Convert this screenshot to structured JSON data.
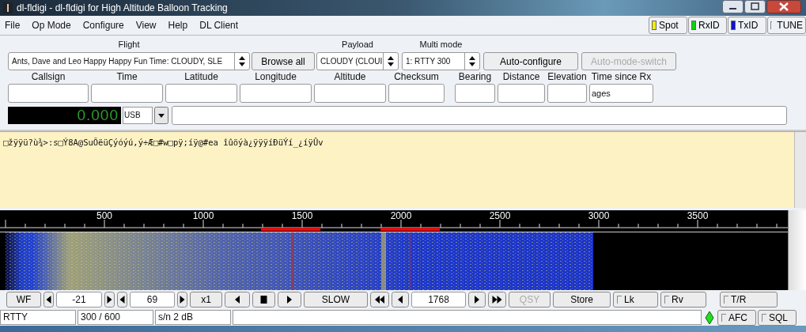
{
  "window": {
    "title": "dl-fldigi - dl-fldigi for High Altitude Balloon Tracking"
  },
  "menu": [
    "File",
    "Op Mode",
    "Configure",
    "View",
    "Help",
    "DL Client"
  ],
  "indicators": [
    {
      "kind": "light",
      "label": "Spot",
      "color": "#f0f000"
    },
    {
      "kind": "light",
      "label": "RxID",
      "color": "#10d010"
    },
    {
      "kind": "light",
      "label": "TxID",
      "color": "#1010d0"
    },
    {
      "kind": "check",
      "label": "TUNE",
      "checked": false
    }
  ],
  "flight": {
    "label": "Flight",
    "value": "Ants, Dave and Leo Happy Happy Fun Time: CLOUDY, SLE"
  },
  "browse": {
    "label": "Browse all"
  },
  "payload": {
    "label": "Payload",
    "value": "CLOUDY (CLOUI"
  },
  "multi_mode": {
    "label": "Multi mode",
    "value": "1: RTTY 300"
  },
  "mode_buttons": [
    {
      "label": "Auto-configure",
      "disabled": false
    },
    {
      "label": "Auto-mode-switch",
      "disabled": true
    }
  ],
  "tracking_fields": [
    {
      "label": "Callsign"
    },
    {
      "label": "Time"
    },
    {
      "label": "Latitude"
    },
    {
      "label": "Longitude"
    },
    {
      "label": "Altitude"
    },
    {
      "label": "Checksum"
    },
    {
      "label": "Bearing"
    },
    {
      "label": "Distance"
    },
    {
      "label": "Elevation"
    },
    {
      "label": "Time since Rx",
      "value": "ages"
    }
  ],
  "frequency": {
    "display": "0.000",
    "mode": "USB"
  },
  "rx_text": "□žÿÿü?ù¾>:s□Ý8A@SuÕëüÇýóýú,ý÷Æ□#w□pÿ;íÿ@#ea îûöýà¿ÿÿÿíÐüÝí_¿íÿÛv",
  "waterfall": {
    "scale_labels": [
      "500",
      "1000",
      "1500",
      "2000",
      "2500",
      "3000",
      "3500"
    ]
  },
  "controls": [
    {
      "kind": "button",
      "label": "WF",
      "disabled": false
    },
    {
      "kind": "left"
    },
    {
      "kind": "value",
      "label": "-21"
    },
    {
      "kind": "right"
    },
    {
      "kind": "left"
    },
    {
      "kind": "value",
      "label": "69"
    },
    {
      "kind": "right"
    },
    {
      "kind": "button",
      "label": "x1",
      "disabled": false
    },
    {
      "kind": "left"
    },
    {
      "kind": "stop"
    },
    {
      "kind": "right"
    },
    {
      "kind": "button",
      "label": "SLOW",
      "disabled": false
    },
    {
      "kind": "fastleft"
    },
    {
      "kind": "left"
    },
    {
      "kind": "value",
      "label": "1768"
    },
    {
      "kind": "right"
    },
    {
      "kind": "fastright"
    },
    {
      "kind": "button",
      "label": "QSY",
      "disabled": true
    },
    {
      "kind": "button",
      "label": "Store",
      "disabled": false
    },
    {
      "kind": "check",
      "label": "Lk",
      "checked": false
    },
    {
      "kind": "check",
      "label": "Rv",
      "checked": false
    },
    {
      "kind": "check",
      "label": "T/R",
      "checked": false
    }
  ],
  "status": {
    "cells": [
      "RTTY",
      "300 / 600",
      "s/n  2 dB"
    ],
    "toggles": [
      {
        "label": "AFC",
        "checked": false
      },
      {
        "label": "SQL",
        "checked": false
      }
    ]
  }
}
